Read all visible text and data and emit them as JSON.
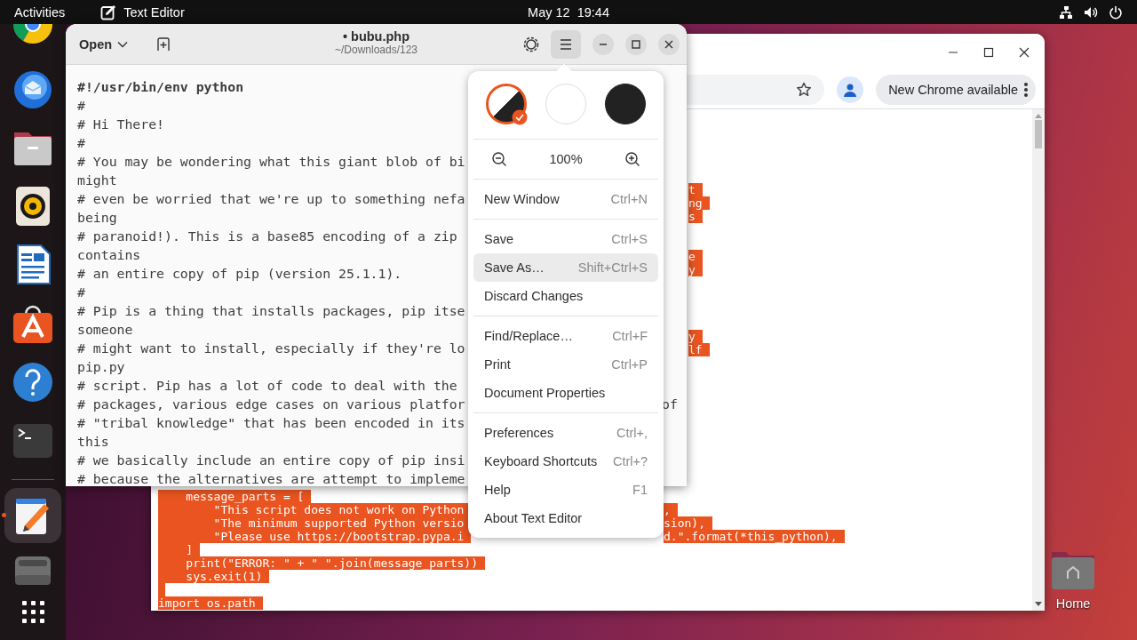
{
  "top_bar": {
    "activities": "Activities",
    "app_name": "Text Editor",
    "clock": "May 12  19:44"
  },
  "dock": {
    "favorites": [
      {
        "kind": "browser",
        "selected": false
      },
      {
        "kind": "mail",
        "selected": false
      },
      {
        "kind": "folder",
        "selected": false
      },
      {
        "kind": "speaker",
        "selected": false
      },
      {
        "kind": "document",
        "selected": false
      },
      {
        "kind": "store",
        "selected": false
      },
      {
        "kind": "help",
        "selected": false
      },
      {
        "kind": "terminal",
        "selected": false
      }
    ],
    "running": [
      {
        "kind": "notepad",
        "selected": true
      },
      {
        "kind": "drive",
        "selected": false
      }
    ]
  },
  "desktop_icons": [
    {
      "label": "Home"
    }
  ],
  "browser": {
    "update_button": "New Chrome available",
    "page_lines": [
      {
        "right": "t",
        "highlighted": true
      },
      {
        "right": "ng",
        "highlighted": true
      },
      {
        "right": "s",
        "highlighted": true
      },
      {
        "highlighted": false
      },
      {
        "highlighted": false
      },
      {
        "right": "e",
        "highlighted": true
      },
      {
        "right": "y",
        "highlighted": true
      },
      {
        "highlighted": false
      },
      {
        "highlighted": false
      },
      {
        "highlighted": false
      },
      {
        "highlighted": false
      },
      {
        "right": "y",
        "highlighted": true
      },
      {
        "right": "lf",
        "highlighted": true
      },
      {
        "highlighted": false
      },
      {
        "highlighted": false
      },
      {
        "highlighted": false
      },
      {
        "highlighted": false
      },
      {
        "highlighted": false
      },
      {
        "highlighted": false
      },
      {
        "highlighted": false
      },
      {
        "highlighted": false
      },
      {
        "highlighted": false
      },
      {
        "highlighted": false
      },
      {
        "left": "    message_parts = [",
        "highlighted": true
      },
      {
        "left": "        \"This script does not work on Python",
        "right": ",",
        "highlighted": true
      },
      {
        "left": "        \"The minimum supported Python versio",
        "right": "sion),",
        "highlighted": true
      },
      {
        "left": "        \"Please use https://bootstrap.pypa.i",
        "right": "d.\".format(*this_python),",
        "highlighted": true
      },
      {
        "left": "    ]",
        "highlighted": true
      },
      {
        "left": "    print(\"ERROR: \" + \" \".join(message_parts))",
        "highlighted": true
      },
      {
        "left": "    sys.exit(1)",
        "highlighted": true
      },
      {
        "highlighted": true
      },
      {
        "left": "import os.path",
        "highlighted": true
      }
    ]
  },
  "editor": {
    "open_label": "Open",
    "title": "• bubu.php",
    "subtitle": "~/Downloads/123",
    "lines": [
      {
        "text": "#!/usr/bin/env python",
        "bold": true
      },
      {
        "text": "#",
        "bold": false
      },
      {
        "text": "# Hi There!",
        "bold": false
      },
      {
        "text": "#",
        "bold": false
      },
      {
        "text": "# You may be wondering what this giant blob of bi",
        "bold": false
      },
      {
        "text": "might",
        "bold": false
      },
      {
        "text": "# even be worried that we're up to something nefa",
        "bold": false
      },
      {
        "text": "being",
        "bold": false
      },
      {
        "text": "# paranoid!). This is a base85 encoding of a zip",
        "bold": false
      },
      {
        "text": "contains",
        "bold": false
      },
      {
        "text": "# an entire copy of pip (version 25.1.1).",
        "bold": false
      },
      {
        "text": "#",
        "bold": false
      },
      {
        "text": "# Pip is a thing that installs packages, pip itse",
        "bold": false
      },
      {
        "text": "someone",
        "bold": false
      },
      {
        "text": "# might want to install, especially if they're lo",
        "bold": false
      },
      {
        "text": "pip.py",
        "bold": false
      },
      {
        "text": "# script. Pip has a lot of code to deal with the",
        "bold": false
      },
      {
        "text": "# packages, various edge cases on various platfor",
        "right": "of",
        "bold": false
      },
      {
        "text": "# \"tribal knowledge\" that has been encoded in its",
        "bold": false
      },
      {
        "text": "this",
        "bold": false
      },
      {
        "text": "# we basically include an entire copy of pip insi",
        "bold": false
      },
      {
        "text": "# because the alternatives are attempt to impleme",
        "bold": false
      }
    ],
    "menu": {
      "open": true,
      "themes": [
        {
          "kind": "system",
          "selected": true
        },
        {
          "kind": "light",
          "selected": false
        },
        {
          "kind": "dark",
          "selected": false
        }
      ],
      "zoom": "100%",
      "sections": [
        [
          {
            "label": "New Window",
            "shortcut": "Ctrl+N",
            "selected": false
          }
        ],
        [
          {
            "label": "Save",
            "shortcut": "Ctrl+S",
            "selected": false
          },
          {
            "label": "Save As…",
            "shortcut": "Shift+Ctrl+S",
            "selected": true
          },
          {
            "label": "Discard Changes",
            "selected": false
          }
        ],
        [
          {
            "label": "Find/Replace…",
            "shortcut": "Ctrl+F",
            "selected": false
          },
          {
            "label": "Print",
            "shortcut": "Ctrl+P",
            "selected": false
          },
          {
            "label": "Document Properties",
            "selected": false
          }
        ],
        [
          {
            "label": "Preferences",
            "shortcut": "Ctrl+,",
            "selected": false
          },
          {
            "label": "Keyboard Shortcuts",
            "shortcut": "Ctrl+?",
            "selected": false
          },
          {
            "label": "Help",
            "shortcut": "F1",
            "selected": false
          },
          {
            "label": "About Text Editor",
            "selected": false
          }
        ]
      ]
    }
  }
}
